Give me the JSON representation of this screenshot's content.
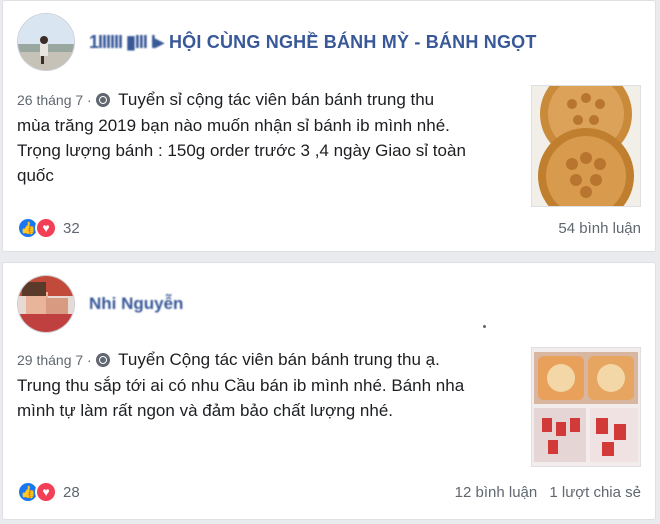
{
  "posts": [
    {
      "author": "HỘI CÙNG NGHỀ BÁNH MỲ - BÁNH NGỌT",
      "author_blurred_prefix": "1IIIIII ▮III I▸",
      "date": "26 tháng 7 ·",
      "text_lines": [
        "Tuyển sỉ cộng tác viên bán bánh trung thu",
        "mùa trăng 2019 bạn nào muốn nhận sỉ bánh ib mình nhé.",
        "Trọng lượng bánh : 150g order trước 3 ,4 ngày Giao sỉ toàn",
        "quốc"
      ],
      "reaction_count": "32",
      "comments": "54 bình luận",
      "shares": ""
    },
    {
      "author": "Nhi Nguyễn",
      "date": "29 tháng 7 ·",
      "text_lines": [
        "Tuyển Cộng tác viên bán bánh trung thu ạ.",
        "Trung thu sắp tới ai có nhu Cầu bán ib mình nhé. Bánh nha",
        "mình tự làm rất ngon và đảm bảo chất lượng nhé."
      ],
      "reaction_count": "28",
      "comments": "12 bình luận",
      "shares": "1 lượt chia sẻ"
    }
  ],
  "icons": {
    "privacy": "globe-icon",
    "like": "like-icon",
    "love": "love-icon"
  },
  "colors": {
    "author": "#385898",
    "like": "#1877f2",
    "love": "#f33e58",
    "background": "#e9ebee"
  }
}
